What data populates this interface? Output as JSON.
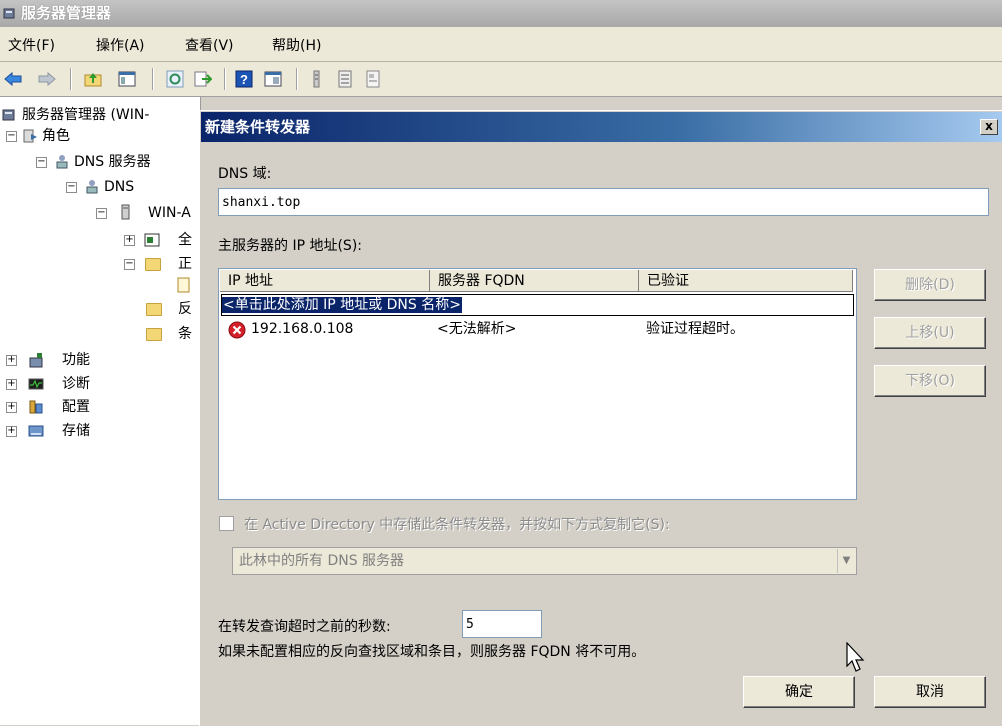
{
  "window": {
    "title": "服务器管理器"
  },
  "menu": [
    "文件(F)",
    "操作(A)",
    "查看(V)",
    "帮助(H)"
  ],
  "toolbar": {
    "icons": [
      "back-arrow-icon",
      "forward-arrow-icon",
      "up-folder-icon",
      "show-hide-tree-icon",
      "refresh-icon",
      "export-list-icon",
      "help-icon",
      "console-tree-icon",
      "detail-view-icon",
      "list-view-icon",
      "properties-icon"
    ]
  },
  "tree": {
    "root": "服务器管理器 (WIN-",
    "roles": "角色",
    "dns_server": "DNS 服务器",
    "dns": "DNS",
    "host": "WIN-A",
    "child_global": "全",
    "child_forward": "正",
    "child_reverse": "反",
    "child_conditional": "条",
    "features": "功能",
    "diagnostics": "诊断",
    "configuration": "配置",
    "storage": "存储"
  },
  "dialog": {
    "title": "新建条件转发器",
    "close": "x",
    "dns_domain_label": "DNS 域:",
    "dns_domain_value": "shanxi.top",
    "master_ip_label": "主服务器的 IP 地址(S):",
    "columns": [
      "IP 地址",
      "服务器 FQDN",
      "已验证"
    ],
    "placeholder": "<单击此处添加 IP 地址或 DNS 名称>",
    "rows": [
      {
        "ip": "192.168.0.108",
        "fqdn": "<无法解析>",
        "verified": "验证过程超时。",
        "status": "error"
      }
    ],
    "buttons": {
      "delete": "删除(D)",
      "up": "上移(U)",
      "down": "下移(O)",
      "ok": "确定",
      "cancel": "取消"
    },
    "ad_store_label": "在 Active Directory 中存储此条件转发器，并按如下方式复制它(S):",
    "ad_store_checked": false,
    "replication_scope": "此林中的所有 DNS 服务器",
    "timeout_label": "在转发查询超时之前的秒数:",
    "timeout_value": "5",
    "note": "如果未配置相应的反向查找区域和条目，则服务器 FQDN 将不可用。"
  },
  "colors": {
    "title_bar": "#0a246a",
    "error": "#d4202a",
    "dialog_bg": "#d4d0c8"
  }
}
